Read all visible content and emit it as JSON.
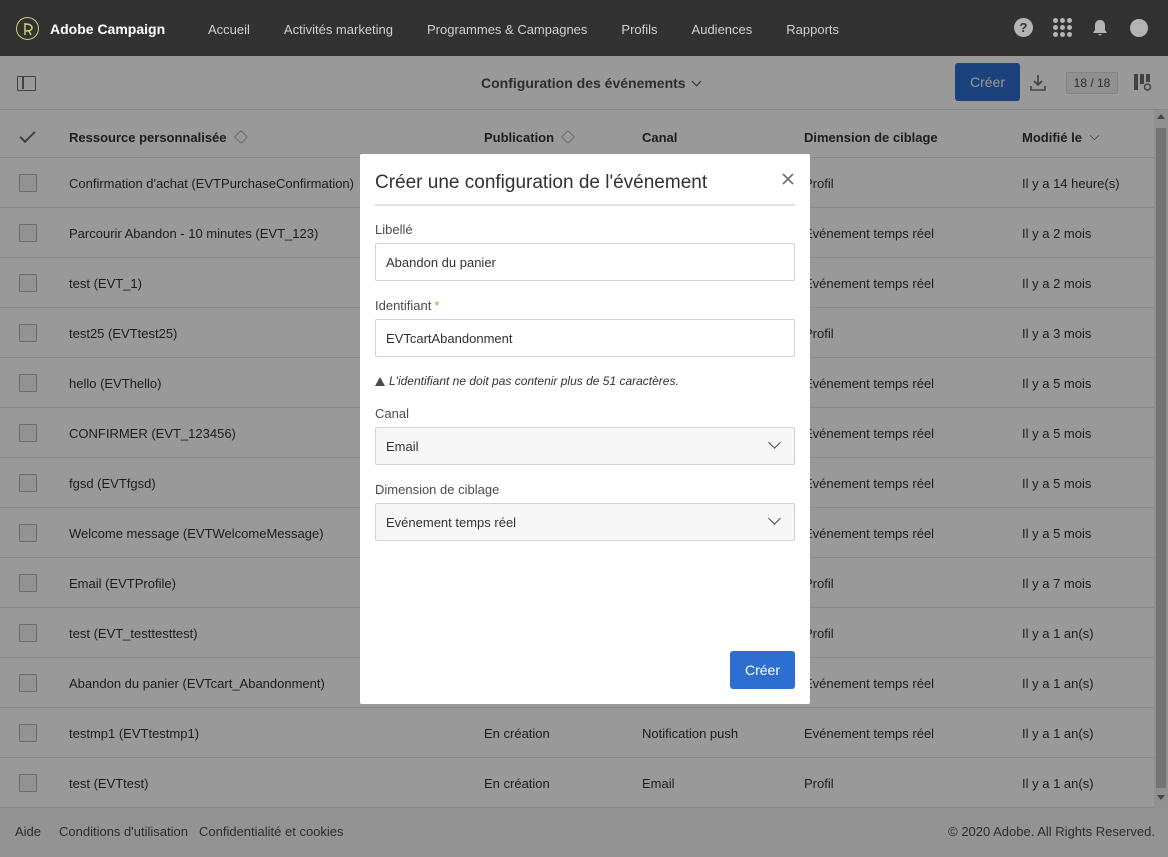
{
  "app": {
    "brand": "Adobe Campaign",
    "nav": [
      "Accueil",
      "Activités marketing",
      "Programmes & Campagnes",
      "Profils",
      "Audiences",
      "Rapports"
    ],
    "help_glyph": "?"
  },
  "toolbar": {
    "title": "Configuration des événements",
    "create_label": "Créer",
    "counter": "18 / 18"
  },
  "table": {
    "headers": {
      "resource": "Ressource personnalisée",
      "publication": "Publication",
      "channel": "Canal",
      "targeting": "Dimension de ciblage",
      "modified": "Modifié le"
    },
    "rows": [
      {
        "name": "Confirmation d'achat (EVTPurchaseConfirmation)",
        "publication": "",
        "channel": "",
        "targeting": "Profil",
        "modified": "Il y a 14 heure(s)"
      },
      {
        "name": "Parcourir Abandon - 10 minutes (EVT_123)",
        "publication": "",
        "channel": "",
        "targeting": "Evénement temps réel",
        "modified": "Il y a 2 mois"
      },
      {
        "name": "test (EVT_1)",
        "publication": "",
        "channel": "",
        "targeting": "Evénement temps réel",
        "modified": "Il y a 2 mois"
      },
      {
        "name": "test25 (EVTtest25)",
        "publication": "",
        "channel": "",
        "targeting": "Profil",
        "modified": "Il y a 3 mois"
      },
      {
        "name": "hello (EVThello)",
        "publication": "",
        "channel": "",
        "targeting": "Evénement temps réel",
        "modified": "Il y a 5 mois"
      },
      {
        "name": "CONFIRMER (EVT_123456)",
        "publication": "",
        "channel": "",
        "targeting": "Evénement temps réel",
        "modified": "Il y a 5 mois"
      },
      {
        "name": "fgsd (EVTfgsd)",
        "publication": "",
        "channel": "",
        "targeting": "Evénement temps réel",
        "modified": "Il y a 5 mois"
      },
      {
        "name": "Welcome message (EVTWelcomeMessage)",
        "publication": "",
        "channel": "",
        "targeting": "Evénement temps réel",
        "modified": "Il y a 5 mois"
      },
      {
        "name": "Email (EVTProfile)",
        "publication": "",
        "channel": "",
        "targeting": "Profil",
        "modified": "Il y a 7 mois"
      },
      {
        "name": "test (EVT_testtesttest)",
        "publication": "",
        "channel": "",
        "targeting": "Profil",
        "modified": "Il y a 1 an(s)"
      },
      {
        "name": "Abandon du panier (EVTcart_Abandonment)",
        "publication": "",
        "channel": "",
        "targeting": "Evénement temps réel",
        "modified": "Il y a 1 an(s)"
      },
      {
        "name": "testmp1 (EVTtestmp1)",
        "publication": "En création",
        "channel": "Notification push",
        "targeting": "Evénement temps réel",
        "modified": "Il y a 1 an(s)"
      },
      {
        "name": "test (EVTtest)",
        "publication": "En création",
        "channel": "Email",
        "targeting": "Profil",
        "modified": "Il y a 1 an(s)"
      }
    ]
  },
  "footer": {
    "help": "Aide",
    "terms": "Conditions d'utilisation",
    "privacy": "Confidentialité et cookies",
    "copyright": "© 2020 Adobe. All Rights Reserved."
  },
  "modal": {
    "title": "Créer une configuration de l'événement",
    "label_field": "Libellé",
    "label_value": "Abandon du panier",
    "id_field": "Identifiant",
    "required_mark": "*",
    "id_value": "EVTcartAbandonment",
    "hint": "L'identifiant ne doit pas contenir plus de 51 caractères.",
    "channel_field": "Canal",
    "channel_value": "Email",
    "targeting_field": "Dimension de ciblage",
    "targeting_value": "Evénement temps réel",
    "create_label": "Créer"
  },
  "colors": {
    "topbar": "#323232",
    "primary": "#2d6fd0",
    "required": "#e68619"
  }
}
